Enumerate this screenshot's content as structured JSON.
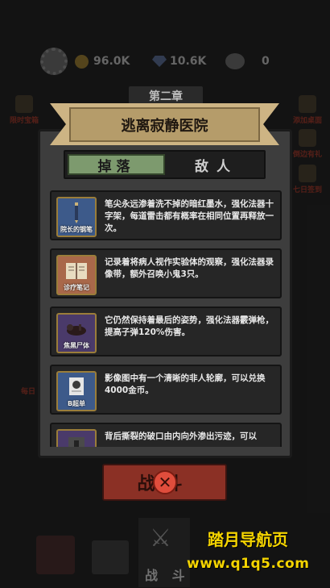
{
  "topbar": {
    "coins": "96.0K",
    "gems": "10.6K",
    "skulls": "0"
  },
  "side_left": [
    {
      "label": "限时宝箱"
    },
    {
      "label": "每日"
    }
  ],
  "side_right": [
    {
      "label": "添加桌面"
    },
    {
      "label": "倒边有礼"
    },
    {
      "label": "七日签到"
    }
  ],
  "chapter": "第二章",
  "dialog": {
    "title": "逃离寂静医院",
    "tabs": {
      "drops": "掉落",
      "enemies": "敌人"
    },
    "items": [
      {
        "name": "院长的钢笔",
        "desc": "笔尖永远渗着洗不掉的暗红墨水，强化法器十字架，每道雷击都有概率在相同位置再释放一次。",
        "color": "#3d5a8a",
        "icon": "pen-icon"
      },
      {
        "name": "诊疗笔记",
        "desc": "记录着将病人视作实验体的观察，强化法器录像带，额外召唤小鬼3只。",
        "color": "#a9684a",
        "icon": "notebook-icon"
      },
      {
        "name": "焦黑尸体",
        "desc": "它仍然保持着最后的姿势，强化法器霰弹枪，提高子弹120%伤害。",
        "color": "#4a3a6a",
        "icon": "corpse-icon"
      },
      {
        "name": "B超单",
        "desc": "影像图中有一个清晰的非人轮廓，可以兑换4000金币。",
        "color": "#3d5a8a",
        "icon": "ultrasound-icon"
      },
      {
        "name": "",
        "desc": "背后撕裂的破口由内向外渗出污迹，可以",
        "color": "#4a3a6a",
        "icon": "torn-coat-icon"
      }
    ]
  },
  "close_area": {
    "battle_text": "战斗",
    "close_glyph": "✕"
  },
  "bottom_nav": {
    "battle_label": "战 斗"
  },
  "watermark": {
    "line1": "踏月导航页",
    "line2": "www.q1q5.com"
  }
}
